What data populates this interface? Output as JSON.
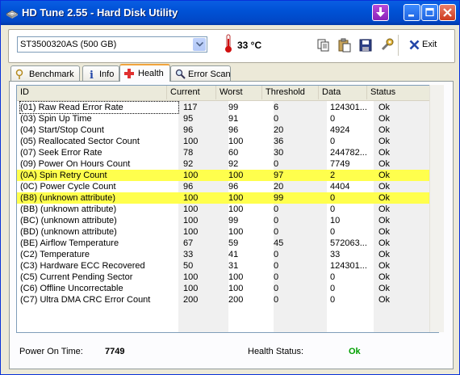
{
  "window": {
    "title": "HD Tune 2.55 - Hard Disk Utility",
    "icon": "app-disk-icon",
    "controls": [
      "download-icon",
      "minimize-icon",
      "maximize-icon",
      "close-icon"
    ]
  },
  "toolbar": {
    "drive": "ST3500320AS (500 GB)",
    "temperature": "33 °C",
    "exit_label": "Exit",
    "icons": [
      "copy-icon",
      "paste-icon",
      "save-icon",
      "options-icon"
    ]
  },
  "tabs": [
    {
      "label": "Benchmark",
      "icon": "benchmark-icon"
    },
    {
      "label": "Info",
      "icon": "info-icon"
    },
    {
      "label": "Health",
      "icon": "health-icon",
      "active": true
    },
    {
      "label": "Error Scan",
      "icon": "magnifier-icon"
    }
  ],
  "table": {
    "headers": [
      "ID",
      "Current",
      "Worst",
      "Threshold",
      "Data",
      "Status"
    ],
    "rows": [
      {
        "id": "(01) Raw Read Error Rate",
        "current": "117",
        "worst": "99",
        "threshold": "6",
        "data": "124301...",
        "status": "Ok"
      },
      {
        "id": "(03) Spin Up Time",
        "current": "95",
        "worst": "91",
        "threshold": "0",
        "data": "0",
        "status": "Ok"
      },
      {
        "id": "(04) Start/Stop Count",
        "current": "96",
        "worst": "96",
        "threshold": "20",
        "data": "4924",
        "status": "Ok"
      },
      {
        "id": "(05) Reallocated Sector Count",
        "current": "100",
        "worst": "100",
        "threshold": "36",
        "data": "0",
        "status": "Ok"
      },
      {
        "id": "(07) Seek Error Rate",
        "current": "78",
        "worst": "60",
        "threshold": "30",
        "data": "244782...",
        "status": "Ok"
      },
      {
        "id": "(09) Power On Hours Count",
        "current": "92",
        "worst": "92",
        "threshold": "0",
        "data": "7749",
        "status": "Ok"
      },
      {
        "id": "(0A) Spin Retry Count",
        "current": "100",
        "worst": "100",
        "threshold": "97",
        "data": "2",
        "status": "Ok",
        "highlight": true
      },
      {
        "id": "(0C) Power Cycle Count",
        "current": "96",
        "worst": "96",
        "threshold": "20",
        "data": "4404",
        "status": "Ok"
      },
      {
        "id": "(B8) (unknown attribute)",
        "current": "100",
        "worst": "100",
        "threshold": "99",
        "data": "0",
        "status": "Ok",
        "highlight": true
      },
      {
        "id": "(BB) (unknown attribute)",
        "current": "100",
        "worst": "100",
        "threshold": "0",
        "data": "0",
        "status": "Ok"
      },
      {
        "id": "(BC) (unknown attribute)",
        "current": "100",
        "worst": "99",
        "threshold": "0",
        "data": "10",
        "status": "Ok"
      },
      {
        "id": "(BD) (unknown attribute)",
        "current": "100",
        "worst": "100",
        "threshold": "0",
        "data": "0",
        "status": "Ok"
      },
      {
        "id": "(BE) Airflow Temperature",
        "current": "67",
        "worst": "59",
        "threshold": "45",
        "data": "572063...",
        "status": "Ok"
      },
      {
        "id": "(C2) Temperature",
        "current": "33",
        "worst": "41",
        "threshold": "0",
        "data": "33",
        "status": "Ok"
      },
      {
        "id": "(C3) Hardware ECC Recovered",
        "current": "50",
        "worst": "31",
        "threshold": "0",
        "data": "124301...",
        "status": "Ok"
      },
      {
        "id": "(C5) Current Pending Sector",
        "current": "100",
        "worst": "100",
        "threshold": "0",
        "data": "0",
        "status": "Ok"
      },
      {
        "id": "(C6) Offline Uncorrectable",
        "current": "100",
        "worst": "100",
        "threshold": "0",
        "data": "0",
        "status": "Ok"
      },
      {
        "id": "(C7) Ultra DMA CRC Error Count",
        "current": "200",
        "worst": "200",
        "threshold": "0",
        "data": "0",
        "status": "Ok"
      }
    ]
  },
  "footer": {
    "power_on_label": "Power On Time:",
    "power_on_value": "7749",
    "health_label": "Health Status:",
    "health_value": "Ok"
  },
  "colors": {
    "highlight": "#ffff4d",
    "health_ok": "#00a000",
    "temperature_icon": "#d01010",
    "title_bar": "#0052d6"
  }
}
